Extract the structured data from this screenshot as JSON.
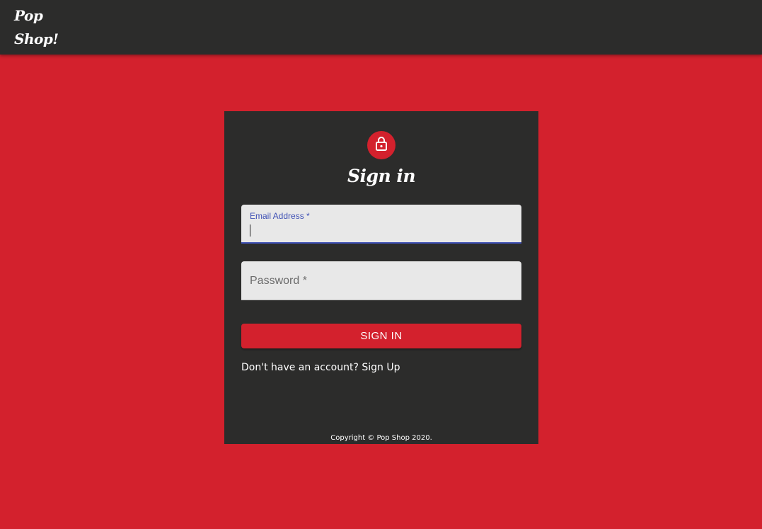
{
  "header": {
    "brand": "Pop Shop!"
  },
  "card": {
    "icon": "lock-icon",
    "title": "Sign in",
    "email": {
      "label": "Email Address *",
      "value": ""
    },
    "password": {
      "label": "Password *",
      "value": ""
    },
    "signin_button": "SIGN IN",
    "signup_link": "Don't have an account? Sign Up",
    "copyright": "Copyright © Pop Shop 2020."
  },
  "colors": {
    "accent": "#d3212d",
    "dark": "#2c2c2b",
    "field_bg": "#e8e8e8",
    "focus": "#3f51b5"
  }
}
